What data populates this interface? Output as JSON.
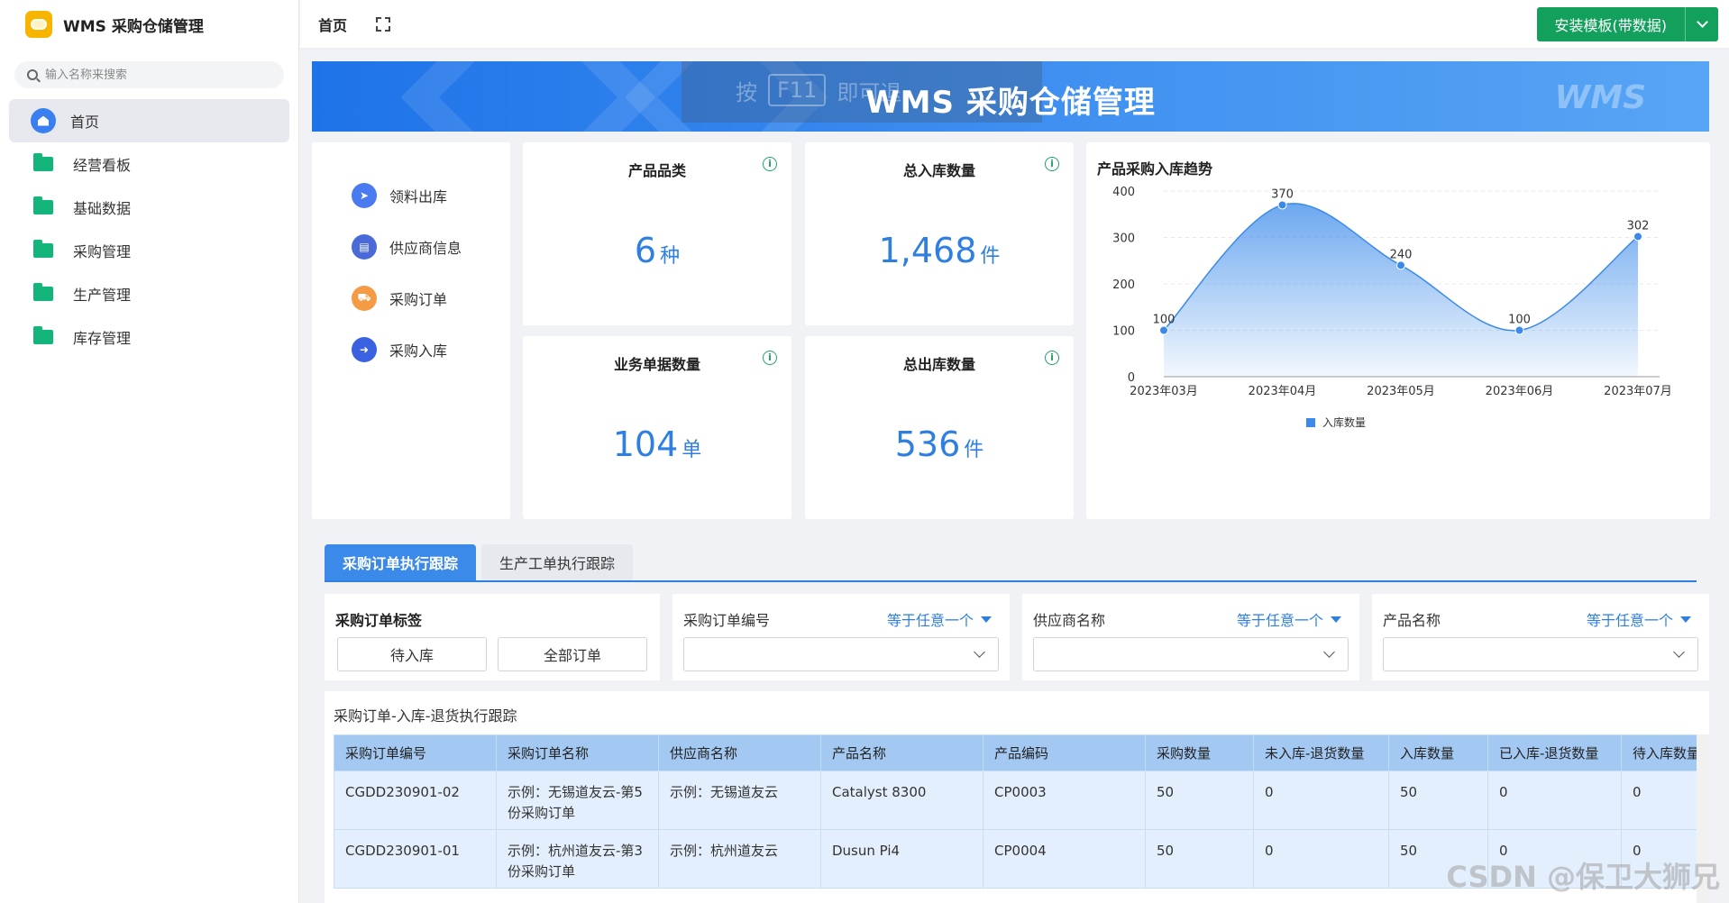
{
  "app": {
    "title": "WMS 采购仓储管理"
  },
  "search": {
    "placeholder": "输入名称来搜索"
  },
  "sidebar": {
    "items": [
      {
        "label": "首页",
        "icon": "home-icon",
        "active": true
      },
      {
        "label": "经营看板",
        "icon": "folder-icon"
      },
      {
        "label": "基础数据",
        "icon": "folder-icon"
      },
      {
        "label": "采购管理",
        "icon": "folder-icon"
      },
      {
        "label": "生产管理",
        "icon": "folder-icon"
      },
      {
        "label": "库存管理",
        "icon": "folder-icon"
      }
    ]
  },
  "topbar": {
    "tab": "首页",
    "install_label": "安装模板(带数据)",
    "accent": "#12a05c"
  },
  "banner": {
    "hint_pre": "按",
    "hint_key": "F11",
    "hint_post": "即可退",
    "title": "WMS 采购仓储管理",
    "logo": "WMS"
  },
  "quick": [
    {
      "label": "领料出库",
      "icon": "send-icon",
      "color": "#4a7af0"
    },
    {
      "label": "供应商信息",
      "icon": "document-icon",
      "color": "#4a6ad8"
    },
    {
      "label": "采购订单",
      "icon": "cart-icon",
      "color": "#f59a45"
    },
    {
      "label": "采购入库",
      "icon": "arrow-right-icon",
      "color": "#3a62e0"
    }
  ],
  "stats": [
    {
      "title": "产品品类",
      "value": "6",
      "unit": "种"
    },
    {
      "title": "总入库数量",
      "value": "1,468",
      "unit": "件"
    },
    {
      "title": "业务单据数量",
      "value": "104",
      "unit": "单"
    },
    {
      "title": "总出库数量",
      "value": "536",
      "unit": "件"
    }
  ],
  "chart": {
    "title": "产品采购入库趋势"
  },
  "chart_data": {
    "type": "area",
    "title": "产品采购入库趋势",
    "categories": [
      "2023年03月",
      "2023年04月",
      "2023年05月",
      "2023年06月",
      "2023年07月"
    ],
    "series": [
      {
        "name": "入库数量",
        "values": [
          100,
          370,
          240,
          100,
          302
        ]
      }
    ],
    "ylim": [
      0,
      400
    ],
    "yticks": [
      0,
      100,
      200,
      300,
      400
    ],
    "legend": "bottom",
    "grid": true,
    "color": "#3b8aea"
  },
  "tabs": [
    "采购订单执行跟踪",
    "生产工单执行跟踪"
  ],
  "filters": {
    "tag_label": "采购订单标签",
    "tag_buttons": [
      "待入库",
      "全部订单"
    ],
    "fields": [
      {
        "label": "采购订单编号",
        "op": "等于任意一个"
      },
      {
        "label": "供应商名称",
        "op": "等于任意一个"
      },
      {
        "label": "产品名称",
        "op": "等于任意一个"
      }
    ]
  },
  "table": {
    "title": "采购订单-入库-退货执行跟踪",
    "columns": [
      "采购订单编号",
      "采购订单名称",
      "供应商名称",
      "产品名称",
      "产品编码",
      "采购数量",
      "未入库-退货数量",
      "入库数量",
      "已入库-退货数量",
      "待入库数量"
    ],
    "rows": [
      [
        "CGDD230901-02",
        "示例：无锡道友云-第5份采购订单",
        "示例：无锡道友云",
        "Catalyst 8300",
        "CP0003",
        "50",
        "0",
        "50",
        "0",
        "0"
      ],
      [
        "CGDD230901-01",
        "示例：杭州道友云-第3份采购订单",
        "示例：杭州道友云",
        "Dusun Pi4",
        "CP0004",
        "50",
        "0",
        "50",
        "0",
        "0"
      ]
    ]
  },
  "watermark": "CSDN @保卫大狮兄"
}
